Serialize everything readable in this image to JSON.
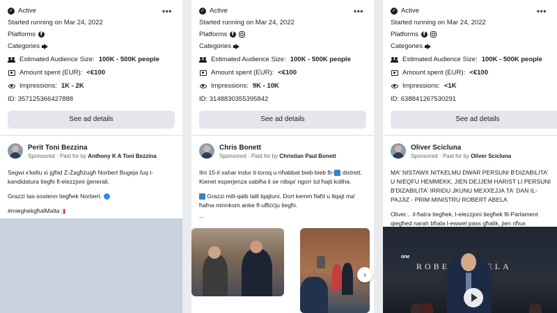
{
  "cards": [
    {
      "status": "Active",
      "started": "Started running on Mar 24, 2022",
      "platforms_label": "Platforms",
      "categories_label": "Categories",
      "audience_label": "Estimated Audience Size:",
      "audience_value": "100K - 500K people",
      "amount_label": "Amount spent (EUR):",
      "amount_value": "<€100",
      "impressions_label": "Impressions:",
      "impressions_value": "1K - 2K",
      "id_text": "ID: 357125366427888",
      "see_label": "See ad details",
      "advertiser": "Perit Toni Bezzina",
      "sponsored": "Sponsored",
      "paid_for": "Paid for by",
      "payer": "Anthony K A Toni Bezzina",
      "body_1": "Segwi x'kellu xi jgħid Ż-Żagħżugħ Norbert Bugeja fuq l-kandidatura tiegħi fl-elezzjoni ġenerali.",
      "body_2": "Grazzi tas-sostenn tiegħek Norbert.",
      "body_3": "#mieghekgħalMalta"
    },
    {
      "status": "Active",
      "started": "Started running on Mar 24, 2022",
      "platforms_label": "Platforms",
      "categories_label": "Categories",
      "audience_label": "Estimated Audience Size:",
      "audience_value": "100K - 500K people",
      "amount_label": "Amount spent (EUR):",
      "amount_value": "<€100",
      "impressions_label": "Impressions:",
      "impressions_value": "9K - 10K",
      "id_text": "ID: 3148830355395842",
      "see_label": "See ad details",
      "advertiser": "Chris Bonett",
      "sponsored": "Sponsored",
      "paid_for": "Paid for by",
      "payer": "Christian Paul Bonett",
      "body_1": "Ilni 15-il xahar indur it-toroq u nħabbat bieb bieb fir-",
      "body_1b": "distrett. Kienet esperjenza sabiħa li se nibqa' ngorr tul ħajti kollha.",
      "body_2": "Grazzi mill-qalb talli lqajtuni. Dort kemm flaħt u ltqajt ma' ħafna minnkom anke fl-uffiċċju tiegħi.",
      "body_3": "...",
      "next_arrow": "›"
    },
    {
      "status": "Active",
      "started": "Started running on Mar 24, 2022",
      "platforms_label": "Platforms",
      "categories_label": "Categories",
      "audience_label": "Estimated Audience Size:",
      "audience_value": "100K - 500K people",
      "amount_label": "Amount spent (EUR):",
      "amount_value": "<€100",
      "impressions_label": "Impressions:",
      "impressions_value": "<1K",
      "id_text": "ID: 638841267530291",
      "see_label": "See ad details",
      "advertiser": "Oliver Scicluna",
      "sponsored": "Sponsored",
      "paid_for": "Paid for by",
      "payer": "Oliver Scicluna",
      "body_1": "MA' NISTAWX NITKELMU DWAR PERSUNI B'DIZABILITA' U NIEQFU HEMMEKK, JIEN DEJJEM HARIST LI PERSUNI B'DIZABILITA' IRRIDU JKUNU MEXXEJJA TA' DAN IL-PAJJIZ - PRIM MINISTRU ROBERT ABELA",
      "body_2": "Oliver... il-ħatra tiegħek, l-elezzjoni tiegħek fil-Parlament qiegħed narah bħala l-ewwel pass għalik, jien nħux qiegħed...",
      "video_sign": "ROBERT ABELA",
      "video_logo": "one"
    }
  ],
  "icons": {
    "active": "check-circle-icon",
    "more": "more-dots-icon",
    "facebook": "facebook-icon",
    "instagram": "instagram-icon",
    "category": "megaphone-icon",
    "audience": "people-icon",
    "amount": "money-icon",
    "impressions": "eye-icon"
  },
  "colors": {
    "page_bg": "#e9ebee",
    "button_bg": "#e4e6eb",
    "muted_text": "#65676b",
    "text": "#1c1e21"
  }
}
